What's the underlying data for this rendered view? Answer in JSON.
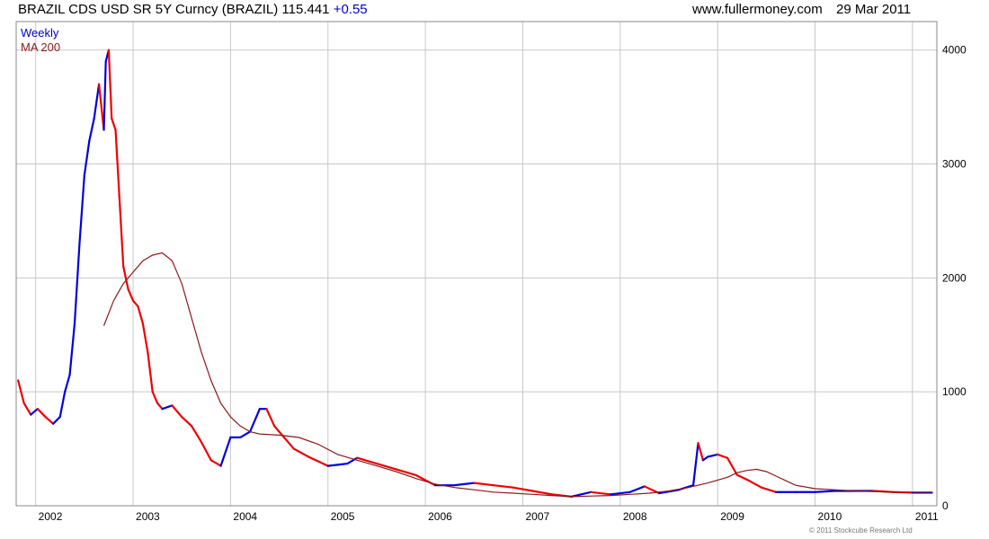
{
  "header": {
    "title": "BRAZIL CDS USD SR 5Y Curncy (BRAZIL) 115.441",
    "change": "+0.55",
    "site": "www.fullermoney.com",
    "date": "29 Mar 2011"
  },
  "legend": {
    "weekly": "Weekly",
    "ma": "MA 200"
  },
  "copyright": "© 2011 Stockcube Research Ltd",
  "colors": {
    "up": "#0000dd",
    "down": "#ee0000",
    "ma": "#8b1a1a",
    "grid": "#c8c8c8",
    "frame": "#888888"
  },
  "chart_data": {
    "type": "line",
    "title": "BRAZIL CDS USD SR 5Y Curncy (BRAZIL) 115.441 +0.55",
    "frequency": "Weekly",
    "x_range": [
      2001.8,
      2011.25
    ],
    "ylim": [
      0,
      4250
    ],
    "y_ticks": [
      0,
      1000,
      2000,
      3000,
      4000
    ],
    "x_ticks": [
      2002,
      2003,
      2004,
      2005,
      2006,
      2007,
      2008,
      2009,
      2010,
      2011
    ],
    "x_tick_labels": [
      "2002",
      "2003",
      "2004",
      "2005",
      "2006",
      "2007",
      "2008",
      "2009",
      "2010",
      "2011"
    ],
    "grid": true,
    "legend_position": "top-left",
    "series": [
      {
        "name": "Weekly",
        "x": [
          2001.82,
          2001.88,
          2001.95,
          2002.02,
          2002.1,
          2002.18,
          2002.25,
          2002.3,
          2002.35,
          2002.4,
          2002.45,
          2002.5,
          2002.55,
          2002.6,
          2002.65,
          2002.7,
          2002.72,
          2002.75,
          2002.78,
          2002.82,
          2002.86,
          2002.9,
          2002.95,
          2003.0,
          2003.05,
          2003.1,
          2003.15,
          2003.2,
          2003.25,
          2003.3,
          2003.4,
          2003.5,
          2003.6,
          2003.7,
          2003.8,
          2003.9,
          2004.0,
          2004.1,
          2004.2,
          2004.3,
          2004.37,
          2004.45,
          2004.55,
          2004.65,
          2004.8,
          2005.0,
          2005.2,
          2005.3,
          2005.5,
          2005.7,
          2005.9,
          2006.1,
          2006.3,
          2006.5,
          2006.7,
          2006.9,
          2007.1,
          2007.3,
          2007.5,
          2007.7,
          2007.9,
          2008.1,
          2008.25,
          2008.4,
          2008.6,
          2008.75,
          2008.8,
          2008.85,
          2008.9,
          2009.0,
          2009.1,
          2009.2,
          2009.3,
          2009.45,
          2009.6,
          2009.8,
          2010.0,
          2010.2,
          2010.4,
          2010.6,
          2010.8,
          2011.0,
          2011.2
        ],
        "values": [
          1100,
          900,
          800,
          850,
          780,
          720,
          780,
          1000,
          1150,
          1600,
          2300,
          2900,
          3200,
          3400,
          3700,
          3300,
          3900,
          4000,
          3400,
          3300,
          2700,
          2100,
          1900,
          1800,
          1750,
          1600,
          1350,
          1000,
          900,
          850,
          880,
          780,
          700,
          560,
          400,
          350,
          600,
          600,
          650,
          850,
          850,
          700,
          600,
          500,
          430,
          350,
          370,
          420,
          370,
          320,
          270,
          180,
          180,
          200,
          180,
          160,
          130,
          100,
          80,
          120,
          100,
          120,
          170,
          110,
          140,
          180,
          550,
          400,
          430,
          450,
          420,
          270,
          230,
          160,
          120,
          120,
          120,
          130,
          130,
          130,
          120,
          115,
          115
        ]
      },
      {
        "name": "MA 200",
        "x": [
          2002.7,
          2002.8,
          2002.9,
          2003.0,
          2003.1,
          2003.2,
          2003.3,
          2003.4,
          2003.5,
          2003.6,
          2003.7,
          2003.8,
          2003.9,
          2004.0,
          2004.1,
          2004.2,
          2004.3,
          2004.5,
          2004.7,
          2004.9,
          2005.1,
          2005.3,
          2005.5,
          2005.7,
          2005.9,
          2006.1,
          2006.3,
          2006.5,
          2006.7,
          2006.9,
          2007.1,
          2007.3,
          2007.5,
          2007.7,
          2007.9,
          2008.1,
          2008.3,
          2008.5,
          2008.7,
          2008.9,
          2009.1,
          2009.2,
          2009.3,
          2009.4,
          2009.5,
          2009.6,
          2009.7,
          2009.8,
          2010.0,
          2010.2,
          2010.4,
          2010.6,
          2010.8,
          2011.0,
          2011.2
        ],
        "values": [
          1580,
          1800,
          1950,
          2050,
          2150,
          2200,
          2220,
          2150,
          1950,
          1650,
          1350,
          1100,
          900,
          780,
          700,
          650,
          630,
          620,
          600,
          540,
          450,
          400,
          350,
          300,
          240,
          190,
          160,
          140,
          120,
          110,
          100,
          90,
          80,
          85,
          90,
          100,
          110,
          130,
          160,
          200,
          250,
          290,
          310,
          320,
          300,
          260,
          220,
          180,
          150,
          140,
          130,
          125,
          120,
          120,
          120
        ]
      }
    ]
  }
}
